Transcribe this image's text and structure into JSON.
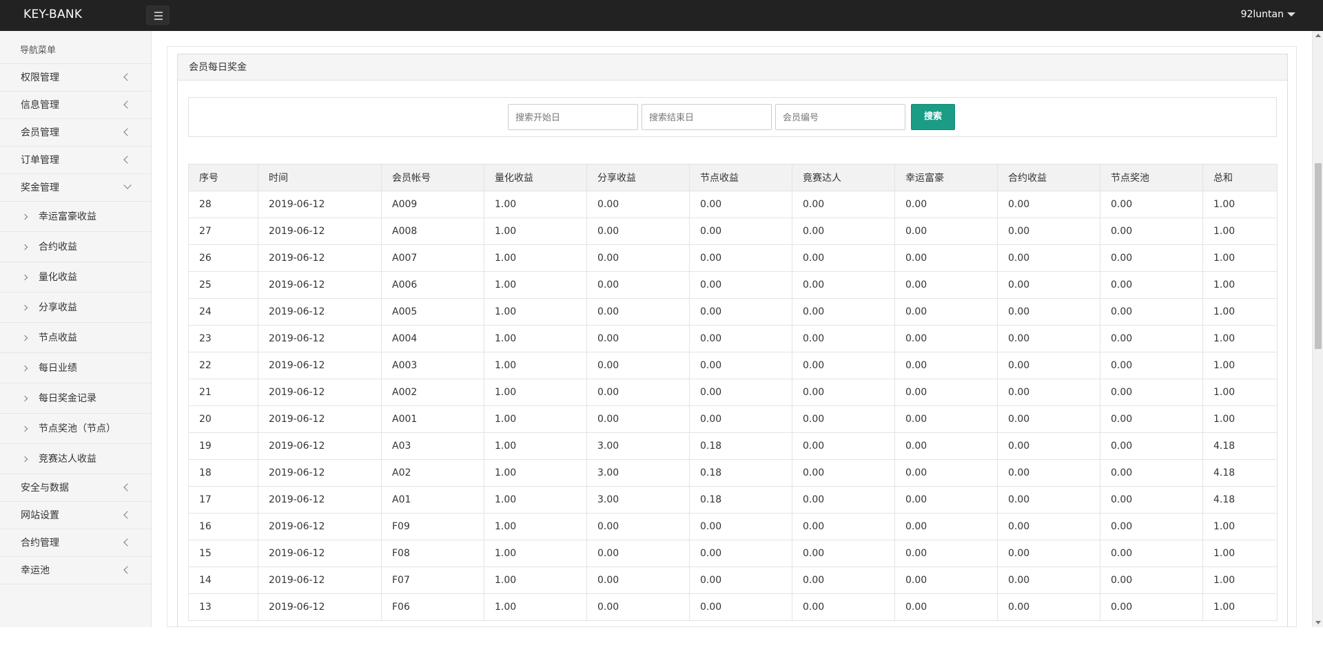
{
  "header": {
    "brand": "KEY-BANK",
    "user": "92luntan"
  },
  "sidebar": {
    "title": "导航菜单",
    "items": [
      {
        "label": "权限管理"
      },
      {
        "label": "信息管理"
      },
      {
        "label": "会员管理"
      },
      {
        "label": "订单管理"
      },
      {
        "label": "奖金管理",
        "expanded": true,
        "children": [
          "幸运富豪收益",
          "合约收益",
          "量化收益",
          "分享收益",
          "节点收益",
          "每日业绩",
          "每日奖金记录",
          "节点奖池（节点）",
          "竞赛达人收益"
        ]
      },
      {
        "label": "安全与数据"
      },
      {
        "label": "网站设置"
      },
      {
        "label": "合约管理"
      },
      {
        "label": "幸运池"
      }
    ]
  },
  "panel": {
    "title": "会员每日奖金"
  },
  "search": {
    "start_placeholder": "搜索开始日",
    "end_placeholder": "搜索结束日",
    "member_placeholder": "会员编号",
    "button": "搜索"
  },
  "table": {
    "headers": [
      "序号",
      "时间",
      "会员帐号",
      "量化收益",
      "分享收益",
      "节点收益",
      "竟赛达人",
      "幸运富豪",
      "合约收益",
      "节点奖池",
      "总和"
    ],
    "rows": [
      [
        "28",
        "2019-06-12",
        "A009",
        "1.00",
        "0.00",
        "0.00",
        "0.00",
        "0.00",
        "0.00",
        "0.00",
        "1.00"
      ],
      [
        "27",
        "2019-06-12",
        "A008",
        "1.00",
        "0.00",
        "0.00",
        "0.00",
        "0.00",
        "0.00",
        "0.00",
        "1.00"
      ],
      [
        "26",
        "2019-06-12",
        "A007",
        "1.00",
        "0.00",
        "0.00",
        "0.00",
        "0.00",
        "0.00",
        "0.00",
        "1.00"
      ],
      [
        "25",
        "2019-06-12",
        "A006",
        "1.00",
        "0.00",
        "0.00",
        "0.00",
        "0.00",
        "0.00",
        "0.00",
        "1.00"
      ],
      [
        "24",
        "2019-06-12",
        "A005",
        "1.00",
        "0.00",
        "0.00",
        "0.00",
        "0.00",
        "0.00",
        "0.00",
        "1.00"
      ],
      [
        "23",
        "2019-06-12",
        "A004",
        "1.00",
        "0.00",
        "0.00",
        "0.00",
        "0.00",
        "0.00",
        "0.00",
        "1.00"
      ],
      [
        "22",
        "2019-06-12",
        "A003",
        "1.00",
        "0.00",
        "0.00",
        "0.00",
        "0.00",
        "0.00",
        "0.00",
        "1.00"
      ],
      [
        "21",
        "2019-06-12",
        "A002",
        "1.00",
        "0.00",
        "0.00",
        "0.00",
        "0.00",
        "0.00",
        "0.00",
        "1.00"
      ],
      [
        "20",
        "2019-06-12",
        "A001",
        "1.00",
        "0.00",
        "0.00",
        "0.00",
        "0.00",
        "0.00",
        "0.00",
        "1.00"
      ],
      [
        "19",
        "2019-06-12",
        "A03",
        "1.00",
        "3.00",
        "0.18",
        "0.00",
        "0.00",
        "0.00",
        "0.00",
        "4.18"
      ],
      [
        "18",
        "2019-06-12",
        "A02",
        "1.00",
        "3.00",
        "0.18",
        "0.00",
        "0.00",
        "0.00",
        "0.00",
        "4.18"
      ],
      [
        "17",
        "2019-06-12",
        "A01",
        "1.00",
        "3.00",
        "0.18",
        "0.00",
        "0.00",
        "0.00",
        "0.00",
        "4.18"
      ],
      [
        "16",
        "2019-06-12",
        "F09",
        "1.00",
        "0.00",
        "0.00",
        "0.00",
        "0.00",
        "0.00",
        "0.00",
        "1.00"
      ],
      [
        "15",
        "2019-06-12",
        "F08",
        "1.00",
        "0.00",
        "0.00",
        "0.00",
        "0.00",
        "0.00",
        "0.00",
        "1.00"
      ],
      [
        "14",
        "2019-06-12",
        "F07",
        "1.00",
        "0.00",
        "0.00",
        "0.00",
        "0.00",
        "0.00",
        "0.00",
        "1.00"
      ],
      [
        "13",
        "2019-06-12",
        "F06",
        "1.00",
        "0.00",
        "0.00",
        "0.00",
        "0.00",
        "0.00",
        "0.00",
        "1.00"
      ]
    ]
  },
  "colors": {
    "topbar": "#222222",
    "accent": "#1a9c85"
  }
}
